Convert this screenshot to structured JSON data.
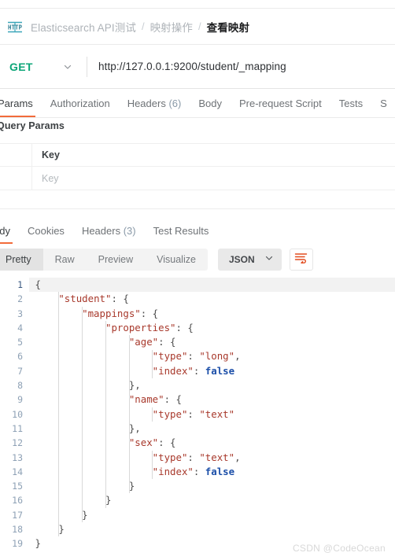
{
  "breadcrumb": {
    "icon": "http-protocol-icon",
    "items": [
      {
        "label": "Elasticsearch API测试",
        "current": false
      },
      {
        "label": "映射操作",
        "current": false
      },
      {
        "label": "查看映射",
        "current": true
      }
    ],
    "separator": "/"
  },
  "request": {
    "method": "GET",
    "method_caret_icon": "chevron-down-icon",
    "url": "http://127.0.0.1:9200/student/_mapping",
    "method_color": "#0ca678"
  },
  "request_tabs": [
    {
      "label": "Params",
      "active": true
    },
    {
      "label": "Authorization",
      "active": false
    },
    {
      "label": "Headers",
      "count": "(6)",
      "active": false
    },
    {
      "label": "Body",
      "active": false
    },
    {
      "label": "Pre-request Script",
      "active": false
    },
    {
      "label": "Tests",
      "active": false
    },
    {
      "label": "S",
      "active": false
    }
  ],
  "query_params": {
    "title": "Query Params",
    "columns": [
      "Key"
    ],
    "header_row": {
      "key": "Key"
    },
    "rows": [
      {
        "key_placeholder": "Key"
      }
    ]
  },
  "response_tabs": [
    {
      "label": "ody",
      "active": true
    },
    {
      "label": "Cookies",
      "active": false
    },
    {
      "label": "Headers",
      "count": "(3)",
      "active": false
    },
    {
      "label": "Test Results",
      "active": false
    }
  ],
  "view_toolbar": {
    "segments": [
      {
        "label": "Pretty",
        "active": true
      },
      {
        "label": "Raw",
        "active": false
      },
      {
        "label": "Preview",
        "active": false
      },
      {
        "label": "Visualize",
        "active": false
      }
    ],
    "format_select": {
      "value": "JSON",
      "caret_icon": "chevron-down-icon"
    },
    "wrap_button_icon": "word-wrap-icon",
    "accent_color": "#f26b3a"
  },
  "response_body": {
    "language": "json",
    "line_numbers": [
      "1",
      "2",
      "3",
      "4",
      "5",
      "6",
      "7",
      "8",
      "9",
      "10",
      "11",
      "12",
      "13",
      "14",
      "15",
      "16",
      "17",
      "18",
      "19"
    ],
    "lines": [
      {
        "n": 1,
        "indent": 0,
        "tokens": [
          {
            "t": "punc",
            "v": "{"
          }
        ]
      },
      {
        "n": 2,
        "indent": 1,
        "tokens": [
          {
            "t": "key",
            "v": "\"student\""
          },
          {
            "t": "punc",
            "v": ": {"
          }
        ]
      },
      {
        "n": 3,
        "indent": 2,
        "tokens": [
          {
            "t": "key",
            "v": "\"mappings\""
          },
          {
            "t": "punc",
            "v": ": {"
          }
        ]
      },
      {
        "n": 4,
        "indent": 3,
        "tokens": [
          {
            "t": "key",
            "v": "\"properties\""
          },
          {
            "t": "punc",
            "v": ": {"
          }
        ]
      },
      {
        "n": 5,
        "indent": 4,
        "tokens": [
          {
            "t": "key",
            "v": "\"age\""
          },
          {
            "t": "punc",
            "v": ": {"
          }
        ]
      },
      {
        "n": 6,
        "indent": 5,
        "tokens": [
          {
            "t": "key",
            "v": "\"type\""
          },
          {
            "t": "punc",
            "v": ": "
          },
          {
            "t": "str",
            "v": "\"long\""
          },
          {
            "t": "punc",
            "v": ","
          }
        ]
      },
      {
        "n": 7,
        "indent": 5,
        "tokens": [
          {
            "t": "key",
            "v": "\"index\""
          },
          {
            "t": "punc",
            "v": ": "
          },
          {
            "t": "bool",
            "v": "false"
          }
        ]
      },
      {
        "n": 8,
        "indent": 4,
        "tokens": [
          {
            "t": "punc",
            "v": "},"
          }
        ]
      },
      {
        "n": 9,
        "indent": 4,
        "tokens": [
          {
            "t": "key",
            "v": "\"name\""
          },
          {
            "t": "punc",
            "v": ": {"
          }
        ]
      },
      {
        "n": 10,
        "indent": 5,
        "tokens": [
          {
            "t": "key",
            "v": "\"type\""
          },
          {
            "t": "punc",
            "v": ": "
          },
          {
            "t": "str",
            "v": "\"text\""
          }
        ]
      },
      {
        "n": 11,
        "indent": 4,
        "tokens": [
          {
            "t": "punc",
            "v": "},"
          }
        ]
      },
      {
        "n": 12,
        "indent": 4,
        "tokens": [
          {
            "t": "key",
            "v": "\"sex\""
          },
          {
            "t": "punc",
            "v": ": {"
          }
        ]
      },
      {
        "n": 13,
        "indent": 5,
        "tokens": [
          {
            "t": "key",
            "v": "\"type\""
          },
          {
            "t": "punc",
            "v": ": "
          },
          {
            "t": "str",
            "v": "\"text\""
          },
          {
            "t": "punc",
            "v": ","
          }
        ]
      },
      {
        "n": 14,
        "indent": 5,
        "tokens": [
          {
            "t": "key",
            "v": "\"index\""
          },
          {
            "t": "punc",
            "v": ": "
          },
          {
            "t": "bool",
            "v": "false"
          }
        ]
      },
      {
        "n": 15,
        "indent": 4,
        "tokens": [
          {
            "t": "punc",
            "v": "}"
          }
        ]
      },
      {
        "n": 16,
        "indent": 3,
        "tokens": [
          {
            "t": "punc",
            "v": "}"
          }
        ]
      },
      {
        "n": 17,
        "indent": 2,
        "tokens": [
          {
            "t": "punc",
            "v": "}"
          }
        ]
      },
      {
        "n": 18,
        "indent": 1,
        "tokens": [
          {
            "t": "punc",
            "v": "}"
          }
        ]
      },
      {
        "n": 19,
        "indent": 0,
        "tokens": [
          {
            "t": "punc",
            "v": "}"
          }
        ]
      }
    ]
  },
  "watermark": "CSDN @CodeOcean"
}
